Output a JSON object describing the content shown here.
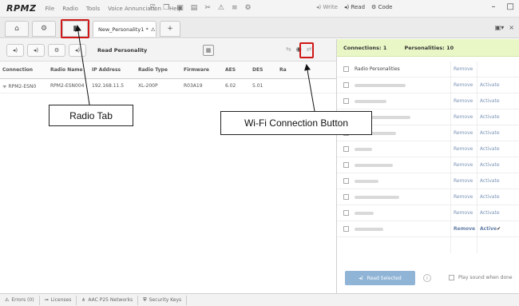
{
  "menubar": {
    "logo": "RPMZ",
    "items": [
      "File",
      "Radio",
      "Tools",
      "Voice Annunciation",
      "Help"
    ],
    "write_label": "Write",
    "read_label": "Read",
    "code_label": "Code"
  },
  "tabs": {
    "document_tab": "New_Personality1 *"
  },
  "toolbar": {
    "read_personality": "Read Personality"
  },
  "table": {
    "headers": [
      "Connection",
      "Radio Name",
      "IP Address",
      "Radio Type",
      "Firmware",
      "AES",
      "DES",
      "Ra"
    ],
    "rows": [
      [
        "RPM2-ESN0",
        "RPM2-ESN004",
        "192.168.11.5",
        "XL-200P",
        "R03A19",
        "6.02",
        "5.01",
        ""
      ]
    ]
  },
  "right_panel": {
    "connections": "Connections: 1",
    "personalities": "Personalities: 10",
    "header_label": "Radio Personalities",
    "header_remove": "Remove",
    "remove_label": "Remove",
    "activate_label": "Activate",
    "active_label": "Active",
    "read_selected": "Read Selected",
    "play_sound": "Play sound when done"
  },
  "statusbar": {
    "errors": "Errors (0)",
    "licenses": "Licenses",
    "aac_networks": "AAC P25 Networks",
    "security_keys": "Security Keys"
  },
  "annotations": {
    "radio_tab": "Radio Tab",
    "wifi_button": "Wi-Fi Connection Button"
  }
}
